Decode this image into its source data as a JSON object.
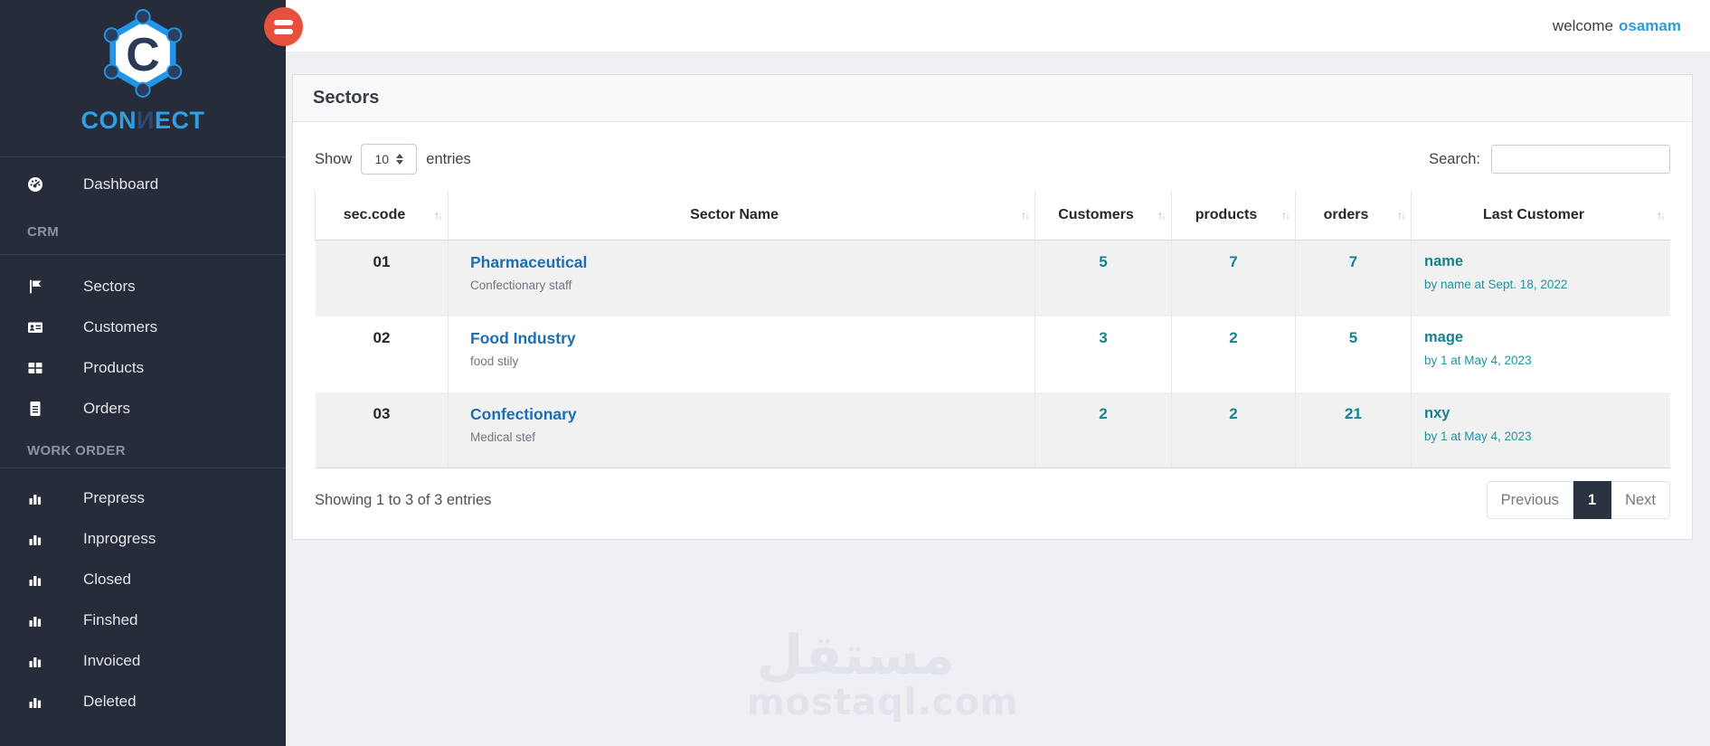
{
  "brand": {
    "logo_letter": "C",
    "name_pre": "CON",
    "name_mid": "И",
    "name_post": "ECT"
  },
  "topbar": {
    "welcome": "welcome",
    "username": "osamam"
  },
  "sidebar": {
    "dashboard": {
      "label": "Dashboard",
      "icon": "tachometer-icon"
    },
    "sections": [
      {
        "label": "CRM",
        "items": [
          {
            "label": "Sectors",
            "icon": "flag-icon"
          },
          {
            "label": "Customers",
            "icon": "id-card-icon"
          },
          {
            "label": "Products",
            "icon": "table-icon"
          },
          {
            "label": "Orders",
            "icon": "file-icon"
          }
        ]
      },
      {
        "label": "WORK ORDER",
        "items": [
          {
            "label": "Prepress",
            "icon": "chart-bar-icon"
          },
          {
            "label": "Inprogress",
            "icon": "chart-bar-icon"
          },
          {
            "label": "Closed",
            "icon": "chart-bar-icon"
          },
          {
            "label": "Finshed",
            "icon": "chart-bar-icon"
          },
          {
            "label": "Invoiced",
            "icon": "chart-bar-icon"
          },
          {
            "label": "Deleted",
            "icon": "chart-bar-icon"
          }
        ]
      }
    ]
  },
  "page": {
    "title": "Sectors"
  },
  "controls": {
    "show_label": "Show",
    "page_length": "10",
    "entries_label": "entries",
    "search_label": "Search:",
    "search_value": ""
  },
  "table": {
    "columns": [
      "sec.code",
      "Sector Name",
      "Customers",
      "products",
      "orders",
      "Last Customer"
    ],
    "rows": [
      {
        "code": "01",
        "sector": "Pharmaceutical",
        "sector_sub": "Confectionary staff",
        "customers": "5",
        "products": "7",
        "orders": "7",
        "last_customer": "name",
        "last_customer_sub": "by name at Sept. 18, 2022"
      },
      {
        "code": "02",
        "sector": "Food Industry",
        "sector_sub": "food stily",
        "customers": "3",
        "products": "2",
        "orders": "5",
        "last_customer": "mage",
        "last_customer_sub": "by 1 at May 4, 2023"
      },
      {
        "code": "03",
        "sector": "Confectionary",
        "sector_sub": "Medical stef",
        "customers": "2",
        "products": "2",
        "orders": "21",
        "last_customer": "nxy",
        "last_customer_sub": "by 1 at May 4, 2023"
      }
    ]
  },
  "footer": {
    "info": "Showing 1 to 3 of 3 entries",
    "previous_label": "Previous",
    "page": "1",
    "next_label": "Next"
  },
  "watermark": {
    "arabic": "مستقل",
    "latin": "mostaql.com"
  },
  "icons": {
    "sort_up": "↑",
    "sort_down": "↓",
    "menu_button": "hamburger-icon"
  },
  "colors": {
    "sidebar_bg": "#272c3a",
    "accent_blue": "#2f9fe3",
    "link_blue": "#1b6fb5",
    "teal": "#17818f",
    "menu_red": "#e8503e",
    "active_page_bg": "#2b3240",
    "stripe": "#f1f1f2",
    "page_bg": "#eef0f4"
  }
}
